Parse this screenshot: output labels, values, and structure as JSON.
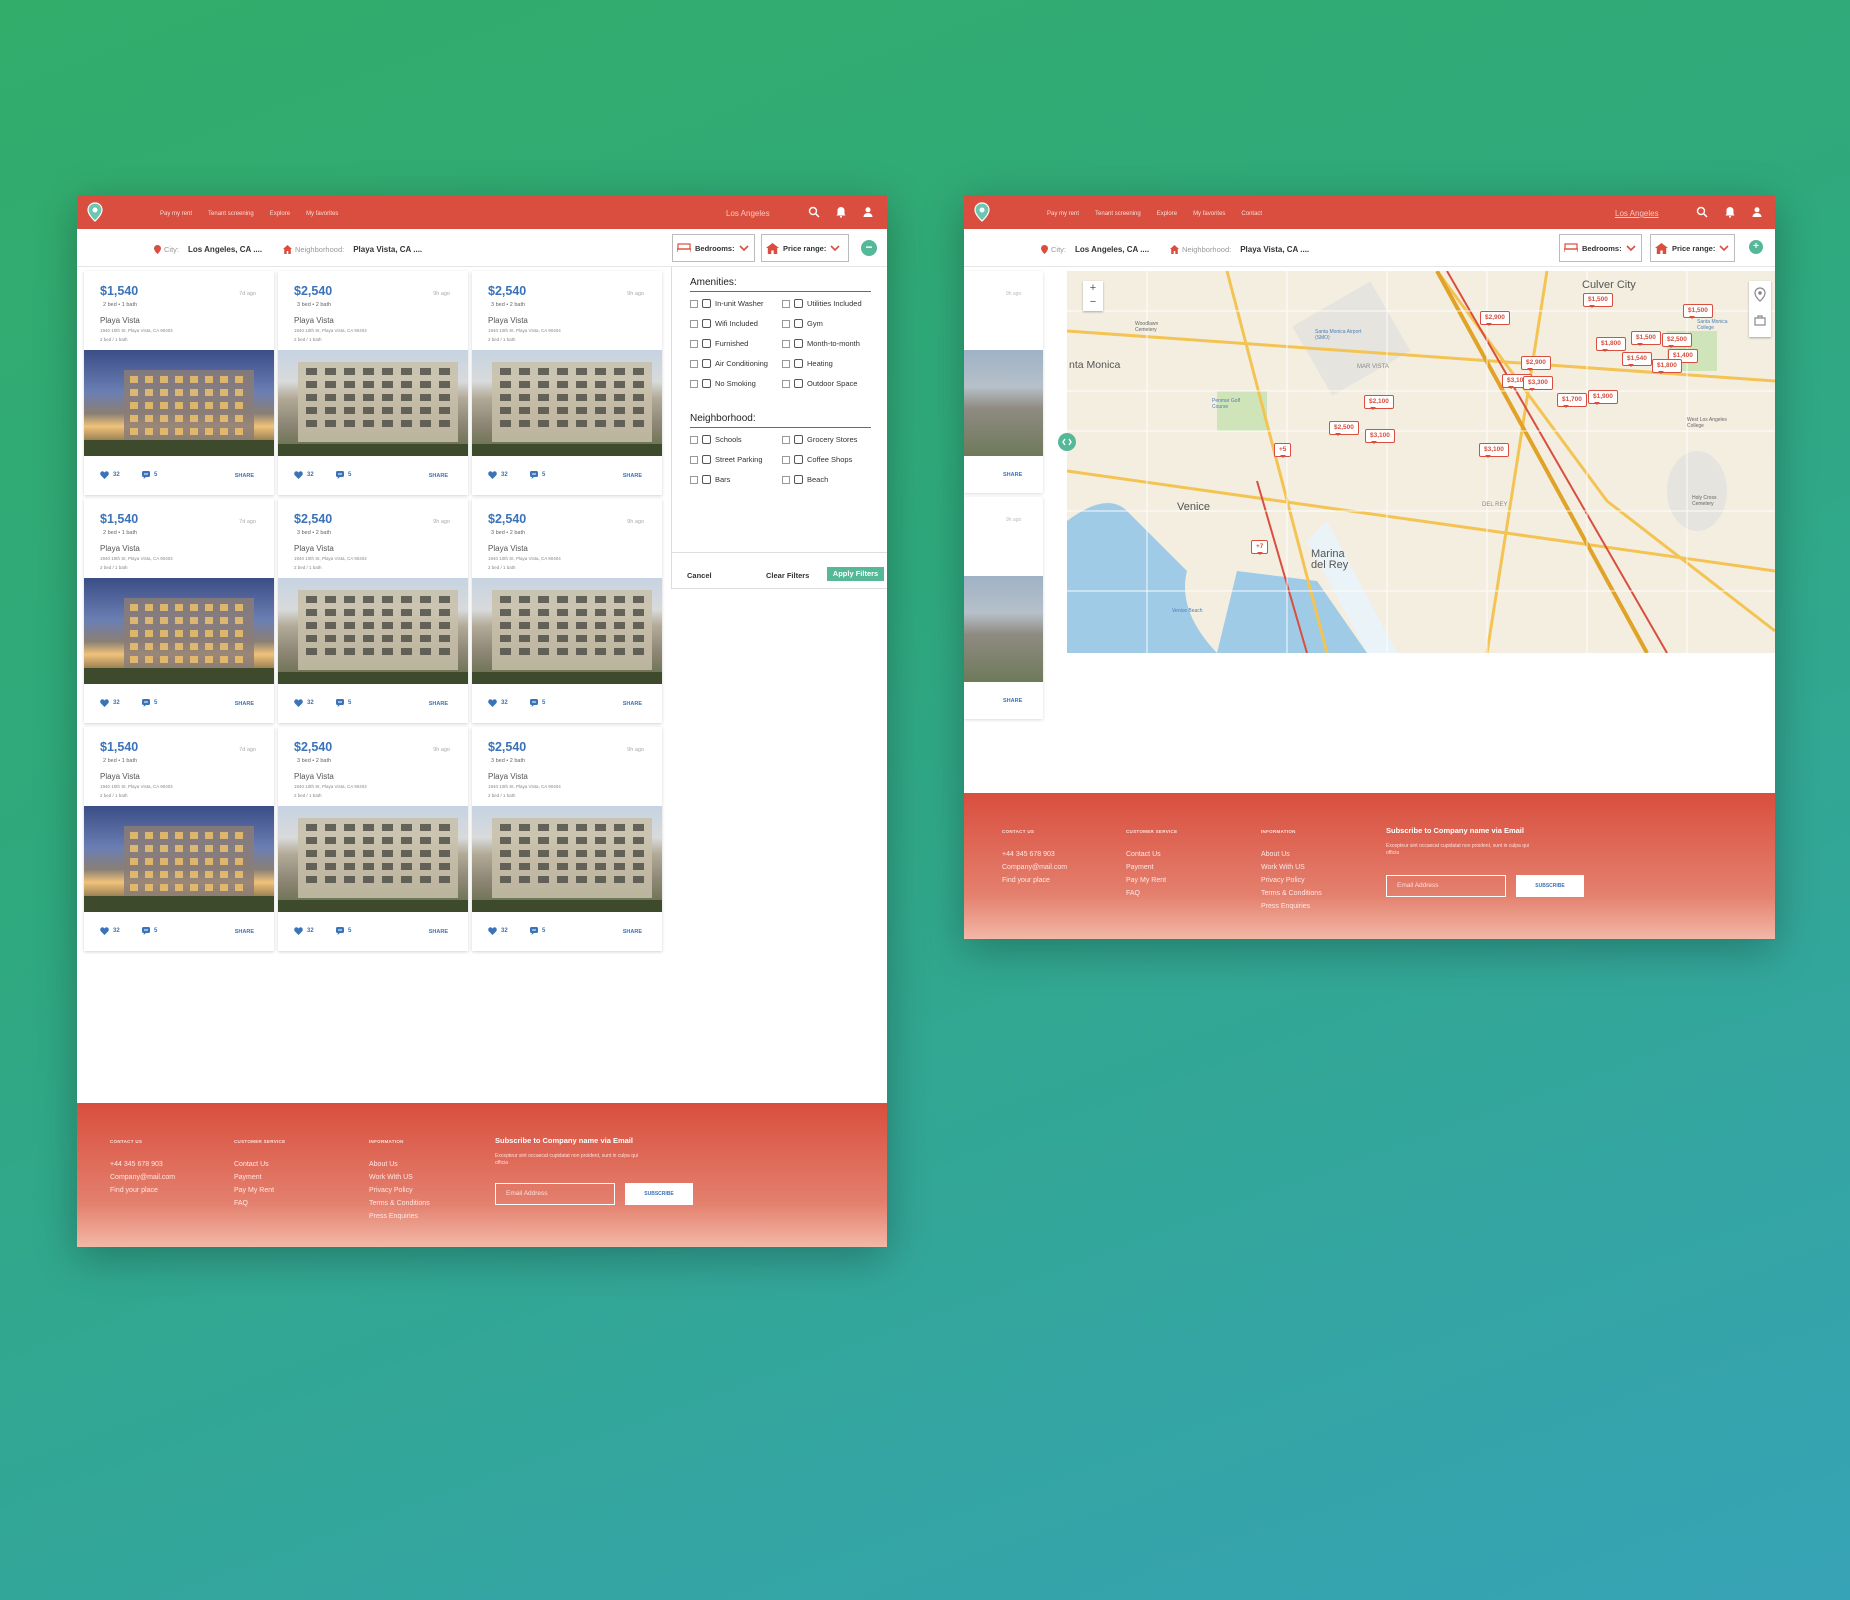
{
  "brand_colors": {
    "primary": "#d94e3e",
    "accent": "#55b898",
    "link": "#3b73b9"
  },
  "nav": {
    "links": [
      "Pay my rent",
      "Tenant screening",
      "Explore",
      "My favorites"
    ],
    "links2": [
      "Pay my rent",
      "Tenant screening",
      "Explore",
      "My favorites",
      "Contact"
    ],
    "city": "Los Angeles",
    "icons": [
      "search-icon",
      "bell-icon",
      "user-icon"
    ]
  },
  "filters": {
    "city_label": "City:",
    "city_value": "Los Angeles, CA ....",
    "hood_label": "Neighborhood:",
    "hood_value": "Playa Vista, CA ....",
    "bedrooms": "Bedrooms:",
    "price": "Price range:",
    "collapse": "−",
    "expand": "+"
  },
  "listings": [
    {
      "price": "$1,540",
      "ago": "7d ago",
      "beds": "2 bed • 1 bath",
      "name": "Playa Vista",
      "addr": "1940 10th St, Playa Vista, CA 90404",
      "bb": "2 bed / 1 bath",
      "likes": "32",
      "comments": "5",
      "share": "SHARE",
      "photo": "a"
    },
    {
      "price": "$2,540",
      "ago": "9h ago",
      "beds": "3 bed • 2 bath",
      "name": "Playa Vista",
      "addr": "1940 10th St, Playa Vista, CA 90404",
      "bb": "2 bed / 1 bath",
      "likes": "32",
      "comments": "5",
      "share": "SHARE",
      "photo": "b"
    },
    {
      "price": "$2,540",
      "ago": "9h ago",
      "beds": "3 bed • 2 bath",
      "name": "Playa Vista",
      "addr": "1940 10th St, Playa Vista, CA 90404",
      "bb": "2 bed / 1 bath",
      "likes": "32",
      "comments": "5",
      "share": "SHARE",
      "photo": "b"
    },
    {
      "price": "$1,540",
      "ago": "7d ago",
      "beds": "2 bed • 1 bath",
      "name": "Playa Vista",
      "addr": "1940 10th St, Playa Vista, CA 90404",
      "bb": "2 bed / 1 bath",
      "likes": "32",
      "comments": "5",
      "share": "SHARE",
      "photo": "a"
    },
    {
      "price": "$2,540",
      "ago": "9h ago",
      "beds": "3 bed • 2 bath",
      "name": "Playa Vista",
      "addr": "1940 10th St, Playa Vista, CA 90404",
      "bb": "2 bed / 1 bath",
      "likes": "32",
      "comments": "5",
      "share": "SHARE",
      "photo": "b"
    },
    {
      "price": "$2,540",
      "ago": "9h ago",
      "beds": "3 bed • 2 bath",
      "name": "Playa Vista",
      "addr": "1940 10th St, Playa Vista, CA 90404",
      "bb": "2 bed / 1 bath",
      "likes": "32",
      "comments": "5",
      "share": "SHARE",
      "photo": "b"
    },
    {
      "price": "$1,540",
      "ago": "7d ago",
      "beds": "2 bed • 1 bath",
      "name": "Playa Vista",
      "addr": "1940 10th St, Playa Vista, CA 90404",
      "bb": "2 bed / 1 bath",
      "likes": "32",
      "comments": "5",
      "share": "SHARE",
      "photo": "a"
    },
    {
      "price": "$2,540",
      "ago": "9h ago",
      "beds": "3 bed • 2 bath",
      "name": "Playa Vista",
      "addr": "1940 10th St, Playa Vista, CA 90404",
      "bb": "2 bed / 1 bath",
      "likes": "32",
      "comments": "5",
      "share": "SHARE",
      "photo": "b"
    },
    {
      "price": "$2,540",
      "ago": "9h ago",
      "beds": "3 bed • 2 bath",
      "name": "Playa Vista",
      "addr": "1940 10th St, Playa Vista, CA 90404",
      "bb": "2 bed / 1 bath",
      "likes": "32",
      "comments": "5",
      "share": "SHARE",
      "photo": "b"
    }
  ],
  "amenities": {
    "title": "Amenities:",
    "items": [
      {
        "label": "In-unit Washer",
        "icon": "washer-icon"
      },
      {
        "label": "Utilities Included",
        "icon": "faucet-icon"
      },
      {
        "label": "Wifi Included",
        "icon": "wifi-icon"
      },
      {
        "label": "Gym",
        "icon": "dumbbell-icon"
      },
      {
        "label": "Furnished",
        "icon": "sofa-icon"
      },
      {
        "label": "Month-to-month",
        "icon": "calendar-icon"
      },
      {
        "label": "Air Conditioning",
        "icon": "snowflake-icon"
      },
      {
        "label": "Heating",
        "icon": "heater-icon"
      },
      {
        "label": "No Smoking",
        "icon": "no-smoking-icon"
      },
      {
        "label": "Outdoor Space",
        "icon": "bench-icon"
      }
    ]
  },
  "neighborhood": {
    "title": "Neighborhood:",
    "items": [
      {
        "label": "Schools",
        "icon": "school-icon"
      },
      {
        "label": "Grocery Stores",
        "icon": "grocery-icon"
      },
      {
        "label": "Street Parking",
        "icon": "car-icon"
      },
      {
        "label": "Coffee Shops",
        "icon": "coffee-icon"
      },
      {
        "label": "Bars",
        "icon": "bar-icon"
      },
      {
        "label": "Beach",
        "icon": "beach-icon"
      }
    ]
  },
  "panel_actions": {
    "cancel": "Cancel",
    "clear": "Clear Filters",
    "apply": "Apply Filters"
  },
  "footer": {
    "contact_h": "CONTACT US",
    "contact": [
      "+44 345 678 903",
      "Company@mail.com",
      "Find your place"
    ],
    "service_h": "CUSTOMER SERVICE",
    "service": [
      "Contact Us",
      "Payment",
      "Pay My Rent",
      "FAQ"
    ],
    "info_h": "INFORMATION",
    "info": [
      "About Us",
      "Work With US",
      "Privacy Policy",
      "Terms & Conditions",
      "Press Enquiries"
    ],
    "sub_title": "Subscribe to Company name via Email",
    "sub_desc": "Excepteur sint occaecat cupidatat non proident, sunt in culpa qui officia",
    "email_placeholder": "Email Address",
    "subscribe": "SUBSCRIBE"
  },
  "map": {
    "labels": [
      "Culver City",
      "nta Monica",
      "Venice",
      "Marina del Rey",
      "MAR VISTA",
      "DEL REY",
      "Santa Monica Airport (SMO)",
      "Woodlawn Cemetery",
      "Santa Monica College",
      "Penmar Golf Course",
      "Venice Beach",
      "West Los Angeles College",
      "Holy Cross Cemetery"
    ],
    "pins": [
      "$2,900",
      "$1,500",
      "$1,500",
      "$1,800",
      "$1,500",
      "$2,500",
      "$1,540",
      "$1,400",
      "$1,800",
      "$2,900",
      "$3,100",
      "$3,300",
      "$1,700",
      "$1,900",
      "$2,100",
      "$2,500",
      "$3,100",
      "$3,100",
      "+5",
      "+7"
    ],
    "zoom_in": "+",
    "zoom_out": "−",
    "share1": "SHARE",
    "share2": "SHARE",
    "ago1": "9h ago",
    "ago2": "9h ago"
  }
}
